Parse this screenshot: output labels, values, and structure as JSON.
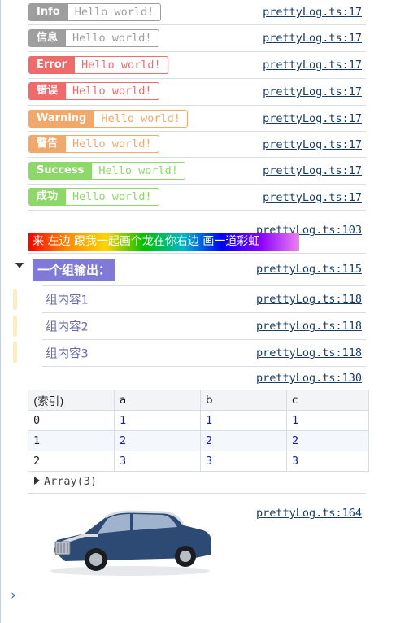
{
  "logs": [
    {
      "tag": "Info",
      "message": "Hello world!",
      "source": "prettyLog.ts:17",
      "color": "#9e9e9e"
    },
    {
      "tag": "信息",
      "message": "Hello world!",
      "source": "prettyLog.ts:17",
      "color": "#9e9e9e"
    },
    {
      "tag": "Error",
      "message": "Hello world!",
      "source": "prettyLog.ts:17",
      "color": "#ef6b6b"
    },
    {
      "tag": "错误",
      "message": "Hello world!",
      "source": "prettyLog.ts:17",
      "color": "#ef6b6b"
    },
    {
      "tag": "Warning",
      "message": "Hello world!",
      "source": "prettyLog.ts:17",
      "color": "#f0a86b"
    },
    {
      "tag": "警告",
      "message": "Hello world!",
      "source": "prettyLog.ts:17",
      "color": "#f0a86b"
    },
    {
      "tag": "Success",
      "message": "Hello world!",
      "source": "prettyLog.ts:17",
      "color": "#8ed86a"
    },
    {
      "tag": "成功",
      "message": "Hello world!",
      "source": "prettyLog.ts:17",
      "color": "#8ed86a"
    }
  ],
  "rainbow": {
    "text": "来 左边 跟我一起画个龙在你右边 画一道彩虹",
    "source": "prettyLog.ts:103"
  },
  "group": {
    "title": "一个组输出：",
    "source": "prettyLog.ts:115",
    "items": [
      {
        "text": "组内容1",
        "source": "prettyLog.ts:118"
      },
      {
        "text": "组内容2",
        "source": "prettyLog.ts:118"
      },
      {
        "text": "组内容3",
        "source": "prettyLog.ts:118"
      }
    ]
  },
  "table": {
    "source": "prettyLog.ts:130",
    "headers": [
      "(索引)",
      "a",
      "b",
      "c"
    ],
    "rows": [
      [
        "0",
        "1",
        "1",
        "1"
      ],
      [
        "1",
        "2",
        "2",
        "2"
      ],
      [
        "2",
        "3",
        "3",
        "3"
      ]
    ],
    "array_label": "Array(3)"
  },
  "image_log": {
    "source": "prettyLog.ts:164",
    "image": "car-image"
  },
  "prompt": {
    "symbol": "›"
  }
}
